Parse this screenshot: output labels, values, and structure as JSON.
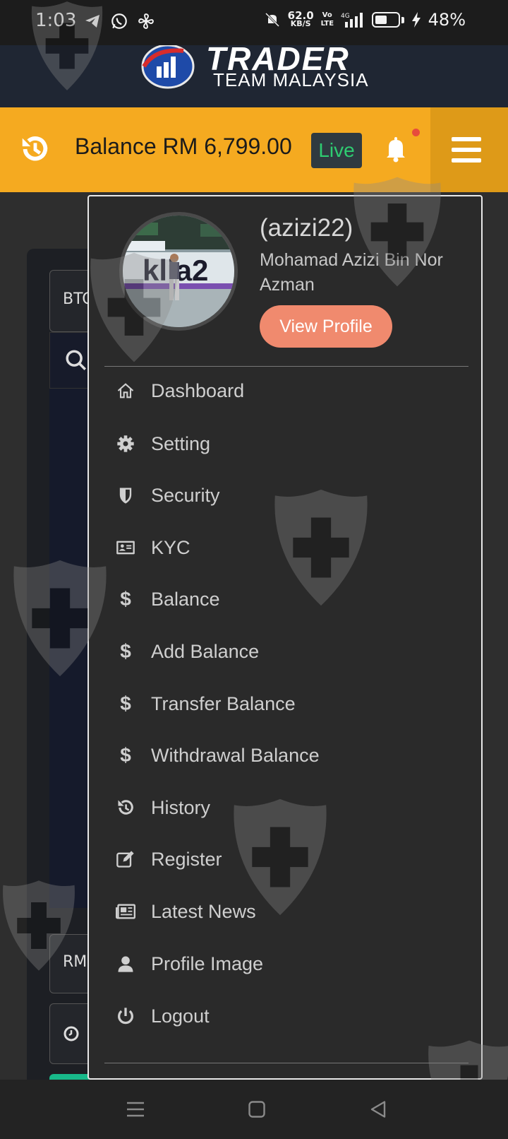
{
  "status_bar": {
    "time": "1:03",
    "net_speed_value": "62.0",
    "net_speed_unit": "KB/S",
    "volte": "Vo LTE",
    "network": "4G",
    "battery": "48%",
    "icons": [
      "telegram-icon",
      "whatsapp-icon",
      "fan-icon",
      "mute-icon",
      "signal-icon",
      "battery-icon",
      "charging-icon"
    ]
  },
  "header": {
    "logo_title": "TRADER",
    "logo_subtitle": "TEAM MALAYSIA"
  },
  "balance_bar": {
    "balance_text": "Balance RM 6,799.00",
    "mode_badge": "Live",
    "accent_color": "#f5aa20",
    "badge_text_color": "#2ecc71"
  },
  "background": {
    "pair_label": "BTC",
    "amount_label": "RM"
  },
  "profile": {
    "username": "(azizi22)",
    "full_name": "Mohamad Azizi Bin Nor Azman",
    "view_profile_label": "View Profile",
    "button_color": "#f08a6e"
  },
  "menu": {
    "items": [
      {
        "label": "Dashboard",
        "icon": "home-icon"
      },
      {
        "label": "Setting",
        "icon": "gear-icon"
      },
      {
        "label": "Security",
        "icon": "shield-icon"
      },
      {
        "label": "KYC",
        "icon": "id-card-icon"
      },
      {
        "label": "Balance",
        "icon": "dollar-icon"
      },
      {
        "label": "Add Balance",
        "icon": "dollar-icon"
      },
      {
        "label": "Transfer Balance",
        "icon": "dollar-icon"
      },
      {
        "label": "Withdrawal Balance",
        "icon": "dollar-icon"
      },
      {
        "label": "History",
        "icon": "history-icon"
      },
      {
        "label": "Register",
        "icon": "edit-icon"
      },
      {
        "label": "Latest News",
        "icon": "newspaper-icon"
      },
      {
        "label": "Profile Image",
        "icon": "user-icon"
      },
      {
        "label": "Logout",
        "icon": "power-icon"
      }
    ]
  },
  "nav_bar": {
    "buttons": [
      "menu-icon",
      "home-square-icon",
      "back-triangle-icon"
    ]
  }
}
